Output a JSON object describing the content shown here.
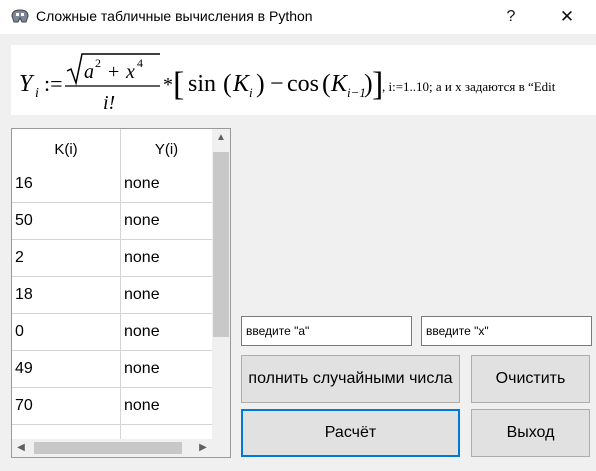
{
  "window": {
    "title": "Сложные табличные вычисления в Python",
    "help": "?",
    "close": "✕"
  },
  "formula": {
    "lhs": "Y",
    "lhs_sub": "i",
    "assign": ":=",
    "sqrt_a": "a",
    "exp_a": "2",
    "plus": "+",
    "sqrt_x": "x",
    "exp_x": "4",
    "denominator": "i!",
    "times": "*",
    "bracket_open": "[",
    "sin": "sin",
    "k": "K",
    "k_sub_i": "i",
    "minus": "−",
    "cos": "cos",
    "k_sub_i_minus_1": "i−1",
    "bracket_close": "]",
    "note": ", i:=1..10; a и x  задаются в “Edit"
  },
  "table": {
    "headers": {
      "k": "K(i)",
      "y": "Y(i)"
    },
    "rows": [
      {
        "k": "16",
        "y": "none"
      },
      {
        "k": "50",
        "y": "none"
      },
      {
        "k": "2",
        "y": "none"
      },
      {
        "k": "18",
        "y": "none"
      },
      {
        "k": "0",
        "y": "none"
      },
      {
        "k": "49",
        "y": "none"
      },
      {
        "k": "70",
        "y": "none"
      }
    ]
  },
  "inputs": {
    "a_placeholder": "введите \"а\"",
    "x_placeholder": "введите \"х\""
  },
  "buttons": {
    "fill_random": "полнить случайными числа",
    "clear": "Очистить",
    "calculate": "Расчёт",
    "exit": "Выход"
  }
}
